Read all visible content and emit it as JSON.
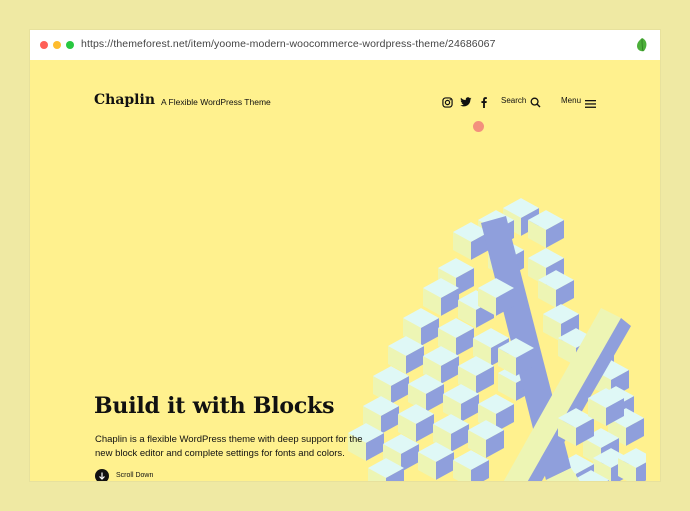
{
  "browser": {
    "url": "https://themeforest.net/item/yoome-modern-woocommerce-wordpress-theme/24686067",
    "extension_icon": "leaf-icon"
  },
  "header": {
    "brand": "Chaplin",
    "tagline": "A Flexible WordPress Theme",
    "social_icons": [
      "instagram-icon",
      "twitter-icon",
      "facebook-icon"
    ],
    "search_label": "Search",
    "menu_label": "Menu"
  },
  "hero": {
    "title": "Build it with Blocks",
    "description": "Chaplin is a flexible WordPress theme with deep support for the new block editor and complete settings for fonts and colors.",
    "scroll_label": "Scroll Down"
  },
  "colors": {
    "background": "#fff18e",
    "block_top": "#dff8f6",
    "block_left": "#edf5b4",
    "block_right": "#8f9fdc",
    "text": "#111111"
  }
}
